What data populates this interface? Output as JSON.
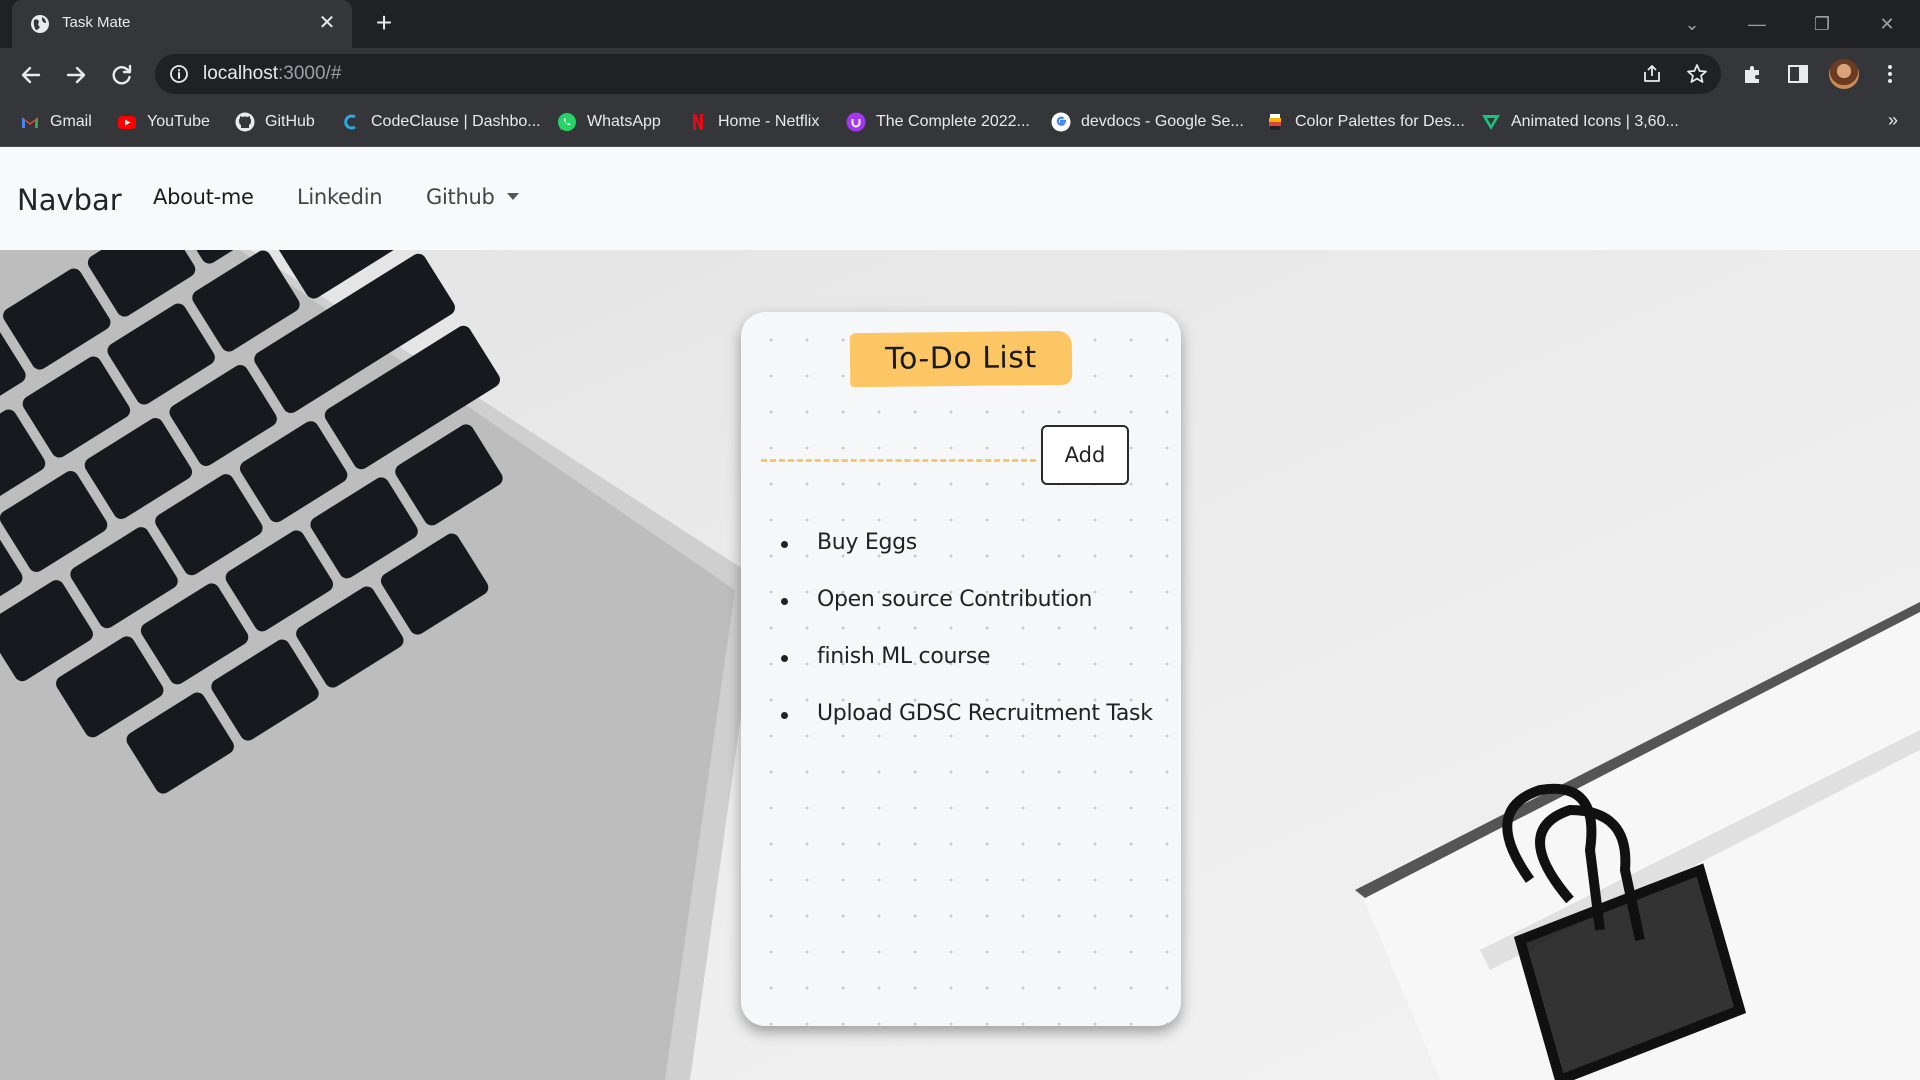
{
  "browser": {
    "tab": {
      "title": "Task Mate",
      "close_symbol": "✕"
    },
    "new_tab_symbol": "+",
    "url_host": "localhost",
    "url_path": ":3000/#",
    "bookmarks": [
      {
        "label": "Gmail",
        "icon": "gmail-icon"
      },
      {
        "label": "YouTube",
        "icon": "youtube-icon"
      },
      {
        "label": "GitHub",
        "icon": "github-icon"
      },
      {
        "label": "CodeClause | Dashbo...",
        "icon": "codeclause-icon"
      },
      {
        "label": "WhatsApp",
        "icon": "whatsapp-icon"
      },
      {
        "label": "Home - Netflix",
        "icon": "netflix-icon"
      },
      {
        "label": "The Complete 2022...",
        "icon": "udemy-icon"
      },
      {
        "label": "devdocs - Google Se...",
        "icon": "google-icon"
      },
      {
        "label": "Color Palettes for Des...",
        "icon": "palette-icon"
      },
      {
        "label": "Animated Icons | 3,60...",
        "icon": "animated-icons-icon"
      }
    ],
    "bookmarks_more": "»"
  },
  "navbar": {
    "brand": "Navbar",
    "links": [
      {
        "label": "About-me"
      },
      {
        "label": "Linkedin"
      },
      {
        "label": "Github"
      }
    ]
  },
  "todo": {
    "title": "To-Do List",
    "input_value": "",
    "input_placeholder": "",
    "add_label": "Add",
    "items": [
      "Buy Eggs",
      "Open source Contribution",
      "finish ML course",
      "Upload GDSC Recruitment Task"
    ]
  },
  "colors": {
    "accent": "#fbc663",
    "chrome_dark": "#202124",
    "chrome_toolbar": "#35363a",
    "navbar_bg": "#f8f9fa",
    "card_bg": "#f6f7f9"
  }
}
